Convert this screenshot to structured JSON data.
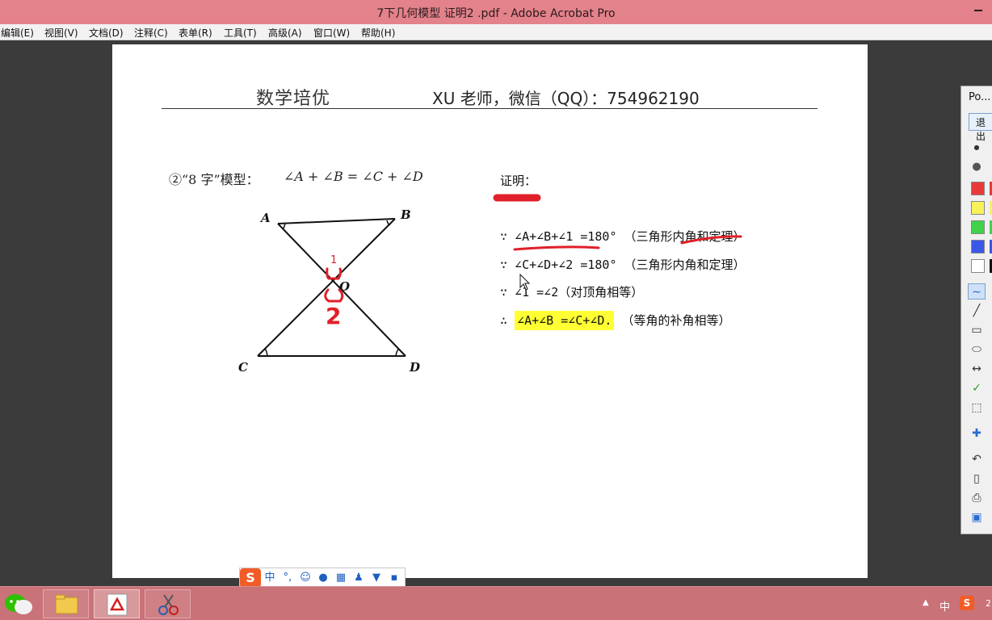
{
  "window": {
    "title": "7下几何模型  证明2  .pdf - Adobe Acrobat Pro"
  },
  "menu": [
    "编辑(E)",
    "视图(V)",
    "文档(D)",
    "注释(C)",
    "表单(R)",
    "工具(T)",
    "高级(A)",
    "窗口(W)",
    "帮助(H)"
  ],
  "document": {
    "header_left": "数学培优",
    "header_right": "XU 老师，微信（QQ）：754962190",
    "model_title": "②“8 字”模型：",
    "model_formula": "∠A + ∠B = ∠C + ∠D",
    "diagram_labels": {
      "a": "A",
      "b": "B",
      "c": "C",
      "d": "D",
      "o": "O"
    },
    "ink_marks": {
      "angle1": "1",
      "angle2": "2"
    },
    "proof_label": "证明：",
    "proof_lines": [
      "∵ ∠A+∠B+∠1 =180° （三角形内角和定理）",
      "∵ ∠C+∠D+∠2 =180° （三角形内角和定理）",
      "∵ ∠1 =∠2（对顶角相等）"
    ],
    "conclusion_prefix": "∴ ",
    "conclusion_highlight": "∠A+∠B =∠C+∠D.",
    "conclusion_suffix": " （等角的补角相等）"
  },
  "ime": {
    "logo": "S",
    "mode": "中",
    "punct": "°,"
  },
  "side_panel": {
    "title": "Po...",
    "exit_button": "退出"
  },
  "tray": {
    "lang": "中",
    "clock": "2"
  },
  "colors": {
    "titlebar": "#e3828a",
    "taskbar": "#c97278",
    "ink": "#e0202a",
    "highlight": "#ffff33"
  }
}
